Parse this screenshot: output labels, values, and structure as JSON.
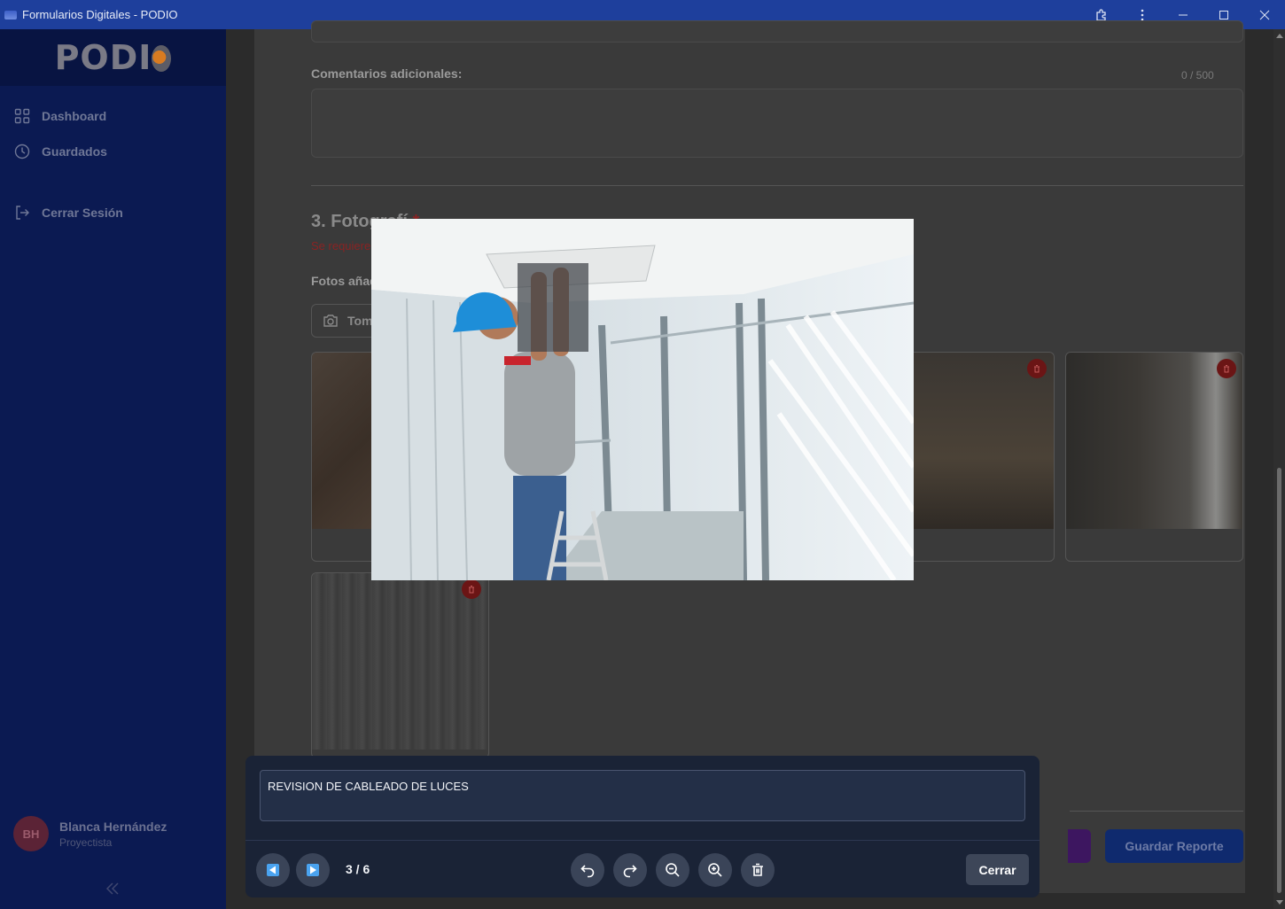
{
  "window": {
    "title": "Formularios Digitales - PODIO"
  },
  "sidebar": {
    "logo_text": "PODIO",
    "items": [
      {
        "label": "Dashboard",
        "icon": "grid-icon"
      },
      {
        "label": "Guardados",
        "icon": "clock-icon"
      },
      {
        "label": "Cerrar Sesión",
        "icon": "logout-icon"
      }
    ],
    "user": {
      "initials": "BH",
      "name": "Blanca Hernández",
      "role": "Proyectista"
    }
  },
  "form": {
    "comments_label": "Comentarios adicionales:",
    "comments_counter": "0 / 500",
    "section_title": "3. Fotografí",
    "section_required": "*",
    "section_subtitle": "Se requieren al r",
    "photos_label": "Fotos añadidas:",
    "take_photo_label": "Tomar Fo",
    "save_report_label": "Guardar Reporte"
  },
  "viewer": {
    "caption": "REVISION DE CABLEADO DE LUCES",
    "counter": "3 / 6",
    "close_label": "Cerrar"
  },
  "colors": {
    "titlebar": "#1e3f9c",
    "sidebar": "#0b1a52",
    "panel": "#1a2336",
    "required": "#8a2323"
  }
}
